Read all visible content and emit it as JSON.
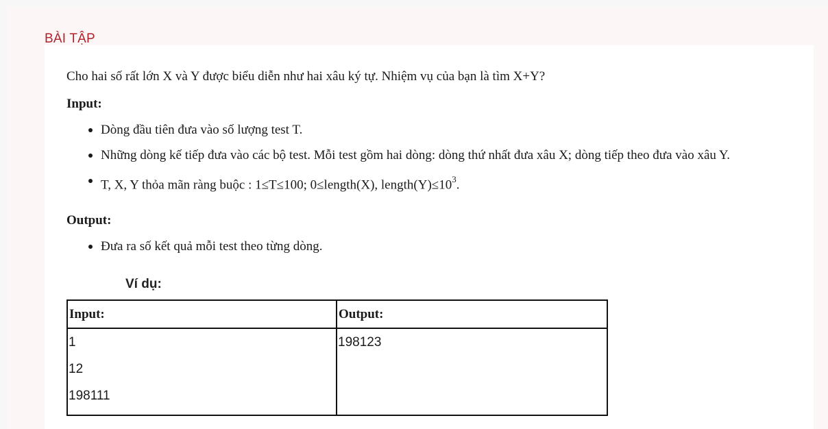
{
  "section_title": "BÀI TẬP",
  "problem": {
    "statement": "Cho hai số rất lớn X và Y được biểu diễn như hai xâu ký tự. Nhiệm vụ của bạn là tìm X+Y?",
    "input_heading": "Input:",
    "input_items": [
      "Dòng đầu tiên đưa vào số lượng test T.",
      "Những dòng kế tiếp đưa vào các bộ test. Mỗi test gồm hai dòng: dòng thứ nhất đưa xâu X; dòng tiếp theo đưa vào xâu Y."
    ],
    "constraint_text": "T, X, Y  thỏa mãn ràng buộc : 1≤T≤100; 0≤length(X), length(Y)≤10",
    "constraint_exp": "3",
    "constraint_end": ".",
    "output_heading": "Output:",
    "output_items": [
      "Đưa ra số kết quả mỗi test theo từng dòng."
    ]
  },
  "example": {
    "label": "Ví dụ:",
    "headers": [
      "Input:",
      "Output:"
    ],
    "input_lines": [
      "1",
      "12",
      "198111"
    ],
    "output_lines": [
      "198123"
    ]
  }
}
